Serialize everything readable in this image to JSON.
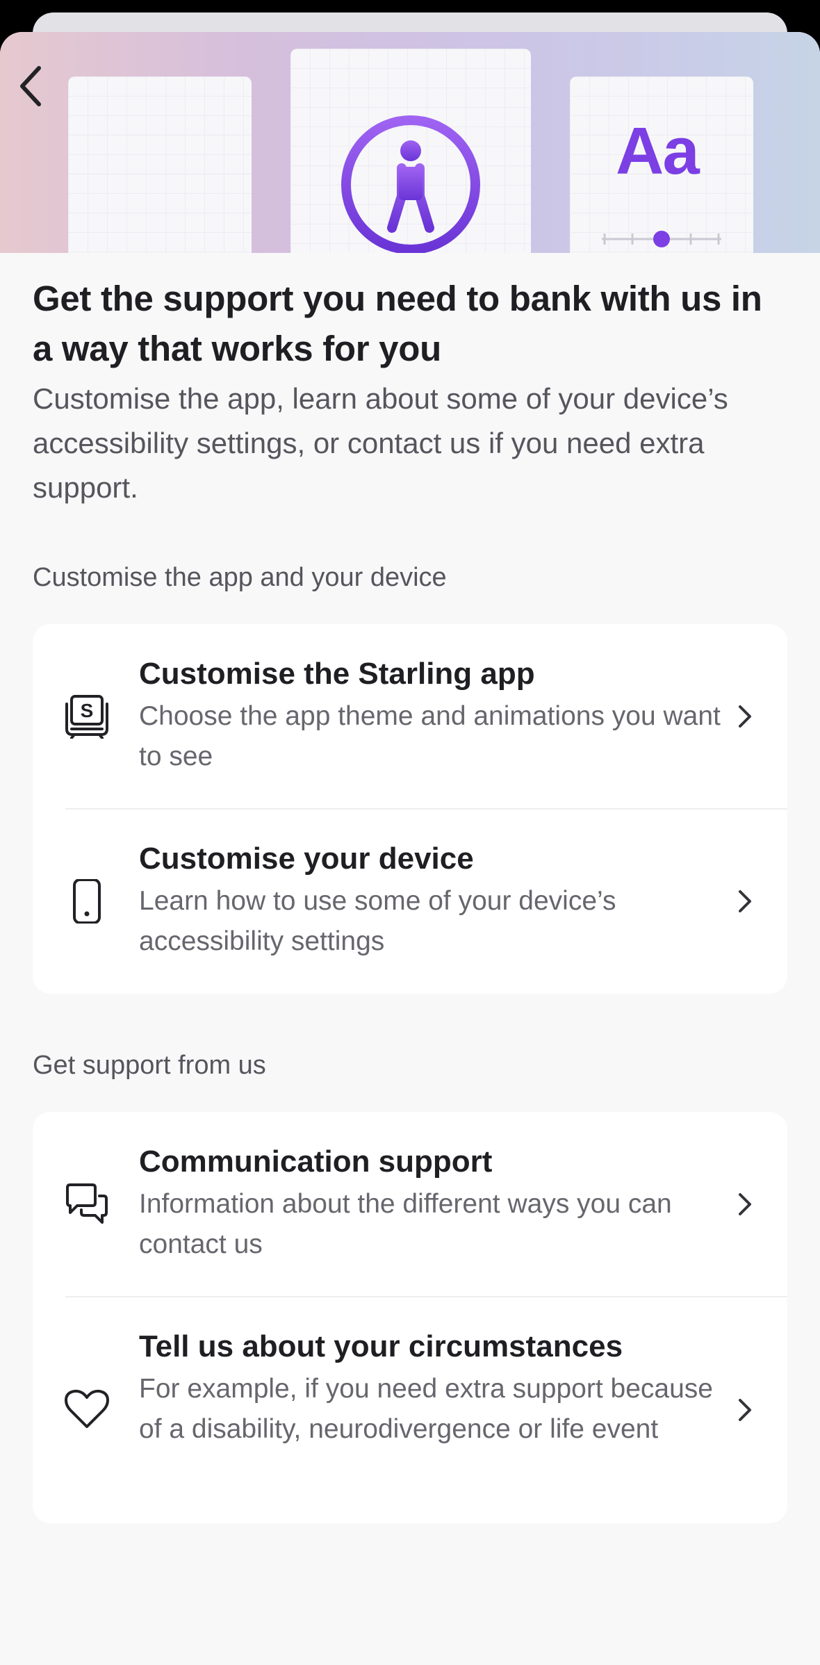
{
  "header": {
    "back_label": "Back",
    "hero_font_sample": "Aa"
  },
  "intro": {
    "headline": "Get the support you need to bank with us in a way that works for you",
    "body": "Customise the app, learn about some of your device’s accessibility settings, or contact us if you need extra support."
  },
  "sections": [
    {
      "label": "Customise the app and your device",
      "items": [
        {
          "icon": "starling-app-icon",
          "title": "Customise the Starling app",
          "description": "Choose the app theme and animations you want to see"
        },
        {
          "icon": "phone-icon",
          "title": "Customise your device",
          "description": "Learn how to use some of your device’s accessibility settings"
        }
      ]
    },
    {
      "label": "Get support from us",
      "items": [
        {
          "icon": "chat-bubbles-icon",
          "title": "Communication support",
          "description": "Information about the different ways you can contact us"
        },
        {
          "icon": "heart-icon",
          "title": "Tell us about your circumstances",
          "description": "For example, if you need extra support because of a disability, neurodivergence or life event"
        }
      ]
    }
  ],
  "colors": {
    "accent_purple": "#7b3fe4",
    "text_primary": "#1f1f23",
    "text_secondary": "#66666d",
    "background": "#f8f8f9",
    "card": "#ffffff"
  }
}
